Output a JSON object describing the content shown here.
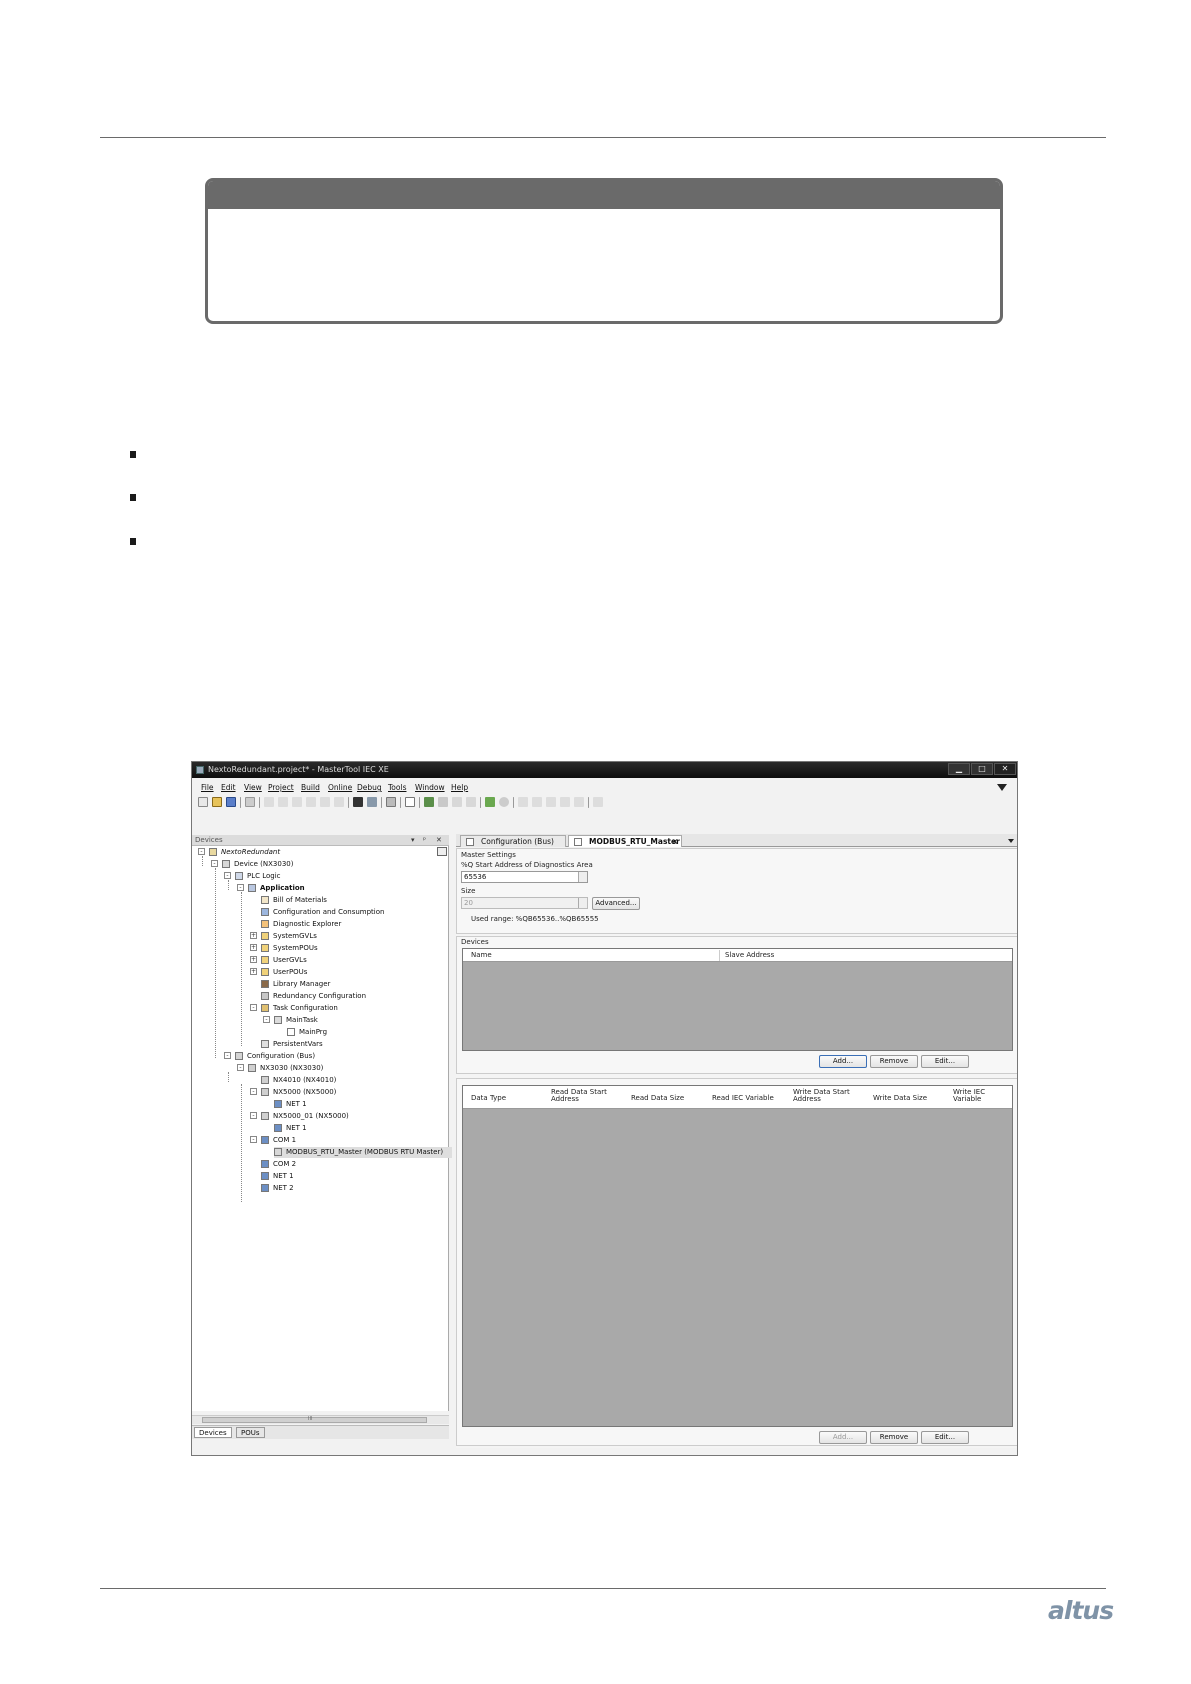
{
  "window": {
    "title": "NextoRedundant.project* - MasterTool IEC XE",
    "controls": {
      "minimize": "▁",
      "maximize": "□",
      "close": "✕"
    }
  },
  "menu": [
    "File",
    "Edit",
    "View",
    "Project",
    "Build",
    "Online",
    "Debug",
    "Tools",
    "Window",
    "Help"
  ],
  "devices_panel": {
    "title": "Devices",
    "tabs": [
      "Devices",
      "POUs"
    ],
    "scroll_marker": "III"
  },
  "tree": [
    {
      "label": "NextoRedundant",
      "level": 0,
      "expander": "-",
      "italic": true,
      "icon": "project-icon"
    },
    {
      "label": "Device (NX3030)",
      "level": 1,
      "expander": "-",
      "icon": "device-icon"
    },
    {
      "label": "PLC Logic",
      "level": 2,
      "expander": "-",
      "icon": "plc-logic-icon"
    },
    {
      "label": "Application",
      "level": 3,
      "expander": "-",
      "bold": true,
      "icon": "application-icon"
    },
    {
      "label": "Bill of Materials",
      "level": 4,
      "icon": "bill-of-materials-icon"
    },
    {
      "label": "Configuration and Consumption",
      "level": 4,
      "icon": "configuration-consumption-icon"
    },
    {
      "label": "Diagnostic Explorer",
      "level": 4,
      "icon": "diagnostic-explorer-icon"
    },
    {
      "label": "SystemGVLs",
      "level": 4,
      "expander": "+",
      "icon": "folder-icon"
    },
    {
      "label": "SystemPOUs",
      "level": 4,
      "expander": "+",
      "icon": "folder-icon"
    },
    {
      "label": "UserGVLs",
      "level": 4,
      "expander": "+",
      "icon": "folder-icon"
    },
    {
      "label": "UserPOUs",
      "level": 4,
      "expander": "+",
      "icon": "folder-icon"
    },
    {
      "label": "Library Manager",
      "level": 4,
      "icon": "library-manager-icon"
    },
    {
      "label": "Redundancy Configuration",
      "level": 4,
      "icon": "redundancy-configuration-icon"
    },
    {
      "label": "Task Configuration",
      "level": 4,
      "expander": "-",
      "icon": "task-configuration-icon"
    },
    {
      "label": "MainTask",
      "level": 5,
      "expander": "-",
      "icon": "task-icon"
    },
    {
      "label": "MainPrg",
      "level": 6,
      "icon": "program-icon"
    },
    {
      "label": "PersistentVars",
      "level": 4,
      "icon": "persistent-vars-icon"
    },
    {
      "label": "Configuration (Bus)",
      "level": 2,
      "expander": "-",
      "icon": "bus-configuration-icon"
    },
    {
      "label": "NX3030 (NX3030)",
      "level": 3,
      "expander": "-",
      "icon": "module-icon"
    },
    {
      "label": "NX4010 (NX4010)",
      "level": 4,
      "icon": "module-icon"
    },
    {
      "label": "NX5000 (NX5000)",
      "level": 4,
      "expander": "-",
      "icon": "module-icon"
    },
    {
      "label": "NET 1",
      "level": 5,
      "icon": "port-icon"
    },
    {
      "label": "NX5000_01 (NX5000)",
      "level": 4,
      "expander": "-",
      "icon": "module-icon"
    },
    {
      "label": "NET 1",
      "level": 5,
      "icon": "port-icon"
    },
    {
      "label": "COM 1",
      "level": 4,
      "expander": "-",
      "icon": "port-icon"
    },
    {
      "label": "MODBUS_RTU_Master (MODBUS RTU Master)",
      "level": 5,
      "icon": "modbus-master-icon",
      "selected": true
    },
    {
      "label": "COM 2",
      "level": 4,
      "icon": "port-icon"
    },
    {
      "label": "NET 1",
      "level": 4,
      "icon": "port-icon"
    },
    {
      "label": "NET 2",
      "level": 4,
      "icon": "port-icon"
    }
  ],
  "doc_tabs": [
    {
      "label": "Configuration (Bus)",
      "active": false
    },
    {
      "label": "MODBUS_RTU_Master",
      "active": true,
      "close": "×"
    }
  ],
  "master_settings": {
    "section_title": "Master Settings",
    "diag_label": "%Q Start Address of Diagnostics Area",
    "diag_value": "65536",
    "size_label": "Size",
    "size_value": "20",
    "advanced_button": "Advanced...",
    "used_range": "Used range: %QB65536..%QB65555"
  },
  "devices_section": {
    "title": "Devices",
    "columns": [
      "Name",
      "Slave Address"
    ],
    "buttons": [
      "Add...",
      "Remove",
      "Edit..."
    ]
  },
  "mapping_section": {
    "columns": [
      "Data Type",
      "Read Data Start Address",
      "Read Data Size",
      "Read IEC Variable",
      "Write Data Start Address",
      "Write Data Size",
      "Write IEC Variable"
    ],
    "buttons": [
      "Add...",
      "Remove",
      "Edit..."
    ]
  },
  "footer": {
    "logo": "altus"
  },
  "colors": {
    "grid_bg": "#a9a9a9",
    "rule": "#6a6a6a",
    "brand": "#7f93a7"
  }
}
